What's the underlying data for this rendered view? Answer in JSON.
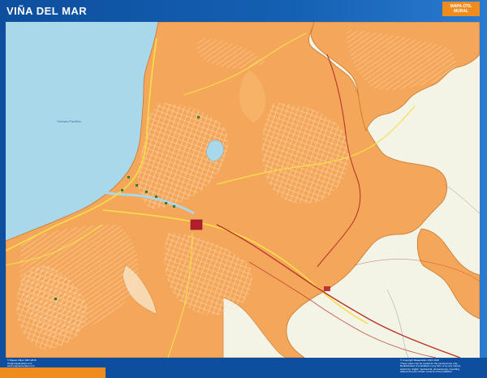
{
  "header": {
    "title": "VIÑA DEL MAR",
    "badge_line1": "MAPA ÚTIL",
    "badge_line2": "MURAL"
  },
  "map": {
    "sea_label": "Océano Pacífico",
    "colors": {
      "frame": "#0d4f9e",
      "urban": "#f4a75a",
      "urban_edge": "#c9762a",
      "sea": "#a9d8ea",
      "land_bg": "#f3f3e6",
      "road_main": "#f5e04a",
      "railway": "#b9352b",
      "landmark": "#b21e2b",
      "accent": "#f08c1e"
    }
  },
  "footer": {
    "left_lines": [
      "© Mapas Útiles 1997-2016",
      "info@mapasutiles.com",
      "www.mapasmurales.com"
    ],
    "right_lines": [
      "© Copyright Mapasutiles 1997-2016",
      "These maps may be copied for the personal use only.",
      "Redistribution is prohibited in any form or by any means,",
      "electronic, digital, mechanical, photocopying, recording,",
      "without the prior written consent of the publisher."
    ]
  }
}
